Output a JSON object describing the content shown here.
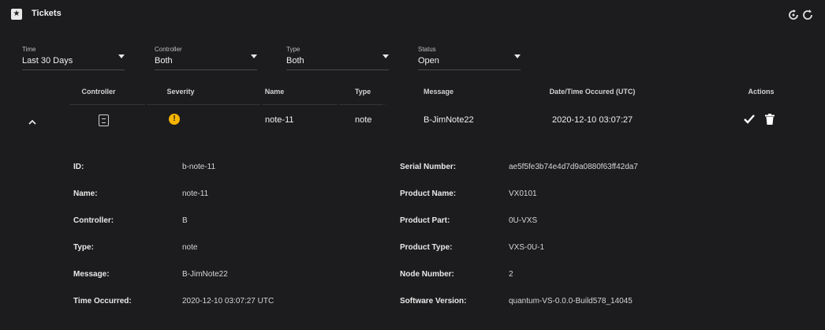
{
  "header": {
    "title": "Tickets",
    "icons": [
      "ticket-icon",
      "refresh-icon",
      "refresh-alt-icon"
    ]
  },
  "filters": [
    {
      "label": "Time",
      "value": "Last 30 Days"
    },
    {
      "label": "Controller",
      "value": "Both"
    },
    {
      "label": "Type",
      "value": "Both"
    },
    {
      "label": "Status",
      "value": "Open"
    }
  ],
  "table": {
    "columns": [
      "Controller",
      "Severity",
      "Name",
      "Type",
      "Message",
      "Date/Time Occured (UTC)",
      "Actions"
    ],
    "row": {
      "controller_icon": "server-icon",
      "severity_icon": "warning-icon",
      "severity_color": "#f5b400",
      "name": "note-11",
      "type": "note",
      "message": "B-JimNote22",
      "datetime": "2020-12-10 03:07:27"
    }
  },
  "details": {
    "left": [
      {
        "label": "ID:",
        "value": "b-note-11"
      },
      {
        "label": "Name:",
        "value": "note-11"
      },
      {
        "label": "Controller:",
        "value": "B"
      },
      {
        "label": "Type:",
        "value": "note"
      },
      {
        "label": "Message:",
        "value": "B-JimNote22"
      },
      {
        "label": "Time Occurred:",
        "value": "2020-12-10 03:07:27 UTC"
      }
    ],
    "right": [
      {
        "label": "Serial Number:",
        "value": "ae5f5fe3b74e4d7d9a0880f63ff42da7"
      },
      {
        "label": "Product Name:",
        "value": "VX0101"
      },
      {
        "label": "Product Part:",
        "value": "0U-VXS"
      },
      {
        "label": "Product Type:",
        "value": "VXS-0U-1"
      },
      {
        "label": "Node Number:",
        "value": "2"
      },
      {
        "label": "Software Version:",
        "value": "quantum-VS-0.0.0-Build578_14045"
      }
    ]
  }
}
